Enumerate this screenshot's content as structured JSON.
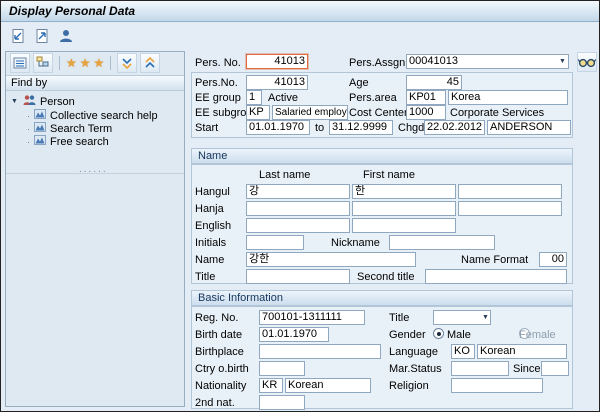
{
  "window_title": "Display Personal Data",
  "colors": {
    "accent_star": "#e8a33d",
    "focus_border": "#df6b3c",
    "panel_bg": "#dfe9f2",
    "box_bg": "#e9f1f8"
  },
  "sidebar": {
    "find_by_label": "Find by",
    "tree": {
      "root_label": "Person",
      "items": [
        "Collective search help",
        "Search Term",
        "Free search"
      ]
    },
    "divider_dots": "......"
  },
  "top": {
    "pers_no_label": "Pers. No.",
    "pers_no": "41013",
    "pers_assgn_label": "Pers.Assgn",
    "pers_assgn": "00041013"
  },
  "overview": {
    "pers_no_label": "Pers.No.",
    "pers_no": "41013",
    "age_label": "Age",
    "age": "45",
    "ee_group_label": "EE group",
    "ee_group": "1",
    "ee_group_text": "Active",
    "pers_area_label": "Pers.area",
    "pers_area": "KP01",
    "pers_area_text": "Korea",
    "ee_subgroup_label": "EE subgroup",
    "ee_subgroup": "KP",
    "ee_subgroup_text": "Salaried employee",
    "cost_center_label": "Cost Center",
    "cost_center": "1000",
    "cost_center_text": "Corporate Services",
    "start_label": "Start",
    "start_date": "01.01.1970",
    "to_label": "to",
    "end_date": "31.12.9999",
    "chgd_label": "Chgd",
    "chgd_date": "22.02.2012",
    "chgd_by": "ANDERSON"
  },
  "name_section": {
    "title": "Name",
    "col_last": "Last name",
    "col_first": "First name",
    "hangul_label": "Hangul",
    "hangul_last": "강",
    "hangul_first": "한",
    "hanja_label": "Hanja",
    "english_label": "English",
    "initials_label": "Initials",
    "nickname_label": "Nickname",
    "name_label": "Name",
    "name_value": "강한",
    "name_format_label": "Name Format",
    "name_format": "00",
    "title_label": "Title",
    "second_title_label": "Second title"
  },
  "basic_section": {
    "title": "Basic Information",
    "reg_no_label": "Reg. No.",
    "reg_no": "700101-1311111",
    "title_label": "Title",
    "birth_date_label": "Birth date",
    "birth_date": "01.01.1970",
    "gender_label": "Gender",
    "male_label": "Male",
    "female_label": "Female",
    "birthplace_label": "Birthplace",
    "language_label": "Language",
    "language_code": "KO",
    "language_text": "Korean",
    "ctry_birth_label": "Ctry o.birth",
    "mar_status_label": "Mar.Status",
    "since_label": "Since",
    "nationality_label": "Nationality",
    "nationality_code": "KR",
    "nationality_text": "Korean",
    "religion_label": "Religion",
    "second_nat_label": "2nd nat."
  }
}
